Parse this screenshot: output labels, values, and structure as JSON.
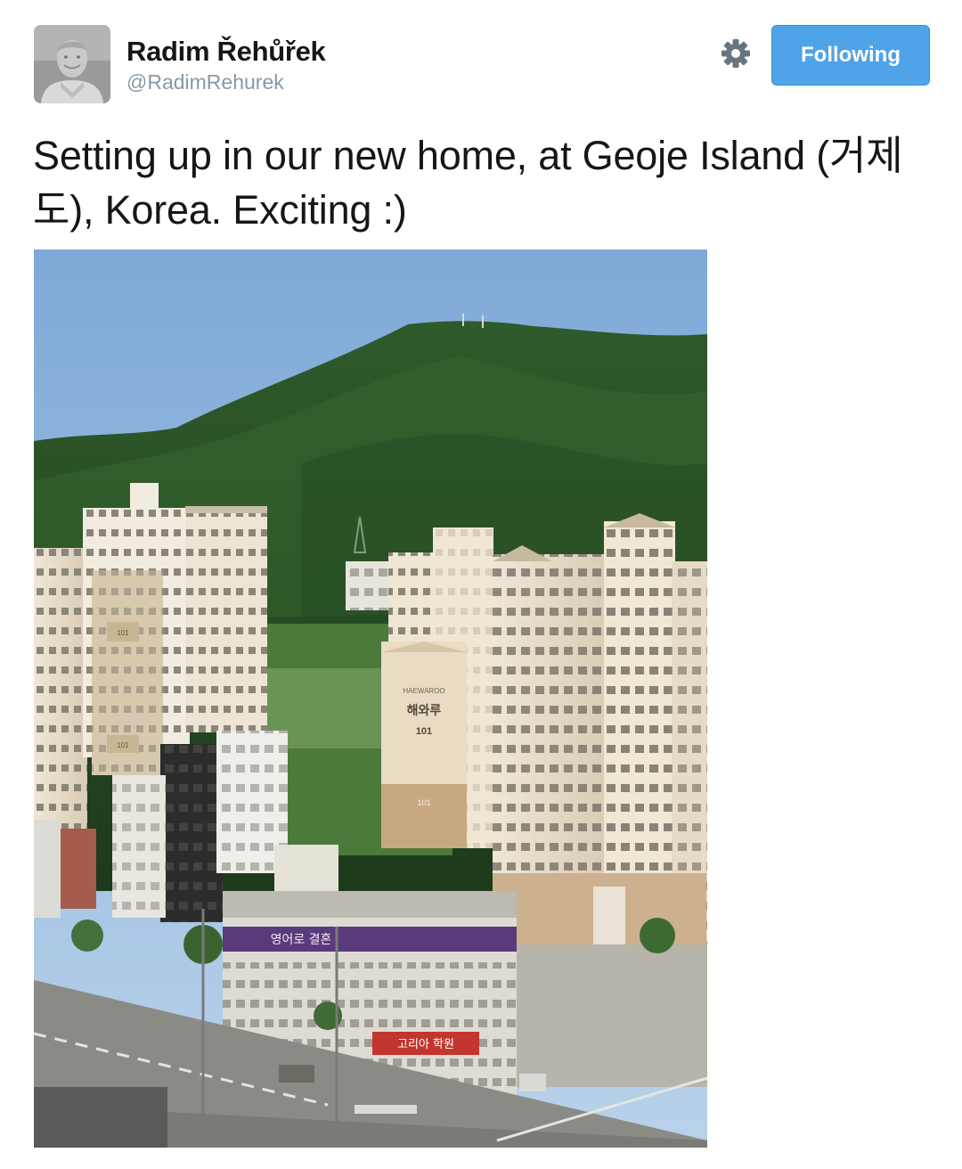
{
  "tweet": {
    "author": {
      "display_name": "Radim Řehůřek",
      "screen_name": "@RadimRehurek",
      "avatar_icon": "avatar-photo"
    },
    "actions": {
      "settings_icon": "gear-icon",
      "follow_label": "Following",
      "follow_color": "#4fa3e8"
    },
    "text": "Setting up in our new home, at Geoje Island (거제도), Korea. Exciting :)",
    "media": {
      "type": "photo",
      "signs": {
        "brand": "HAEWAROO",
        "korean": "해와루",
        "building_number": "101",
        "building_number_low": "101",
        "left_tower_number": "101",
        "left_tower_number_low": "101",
        "street_sign_top": "영어로 결혼",
        "street_sign_bottom": "고리아 학원"
      }
    }
  }
}
